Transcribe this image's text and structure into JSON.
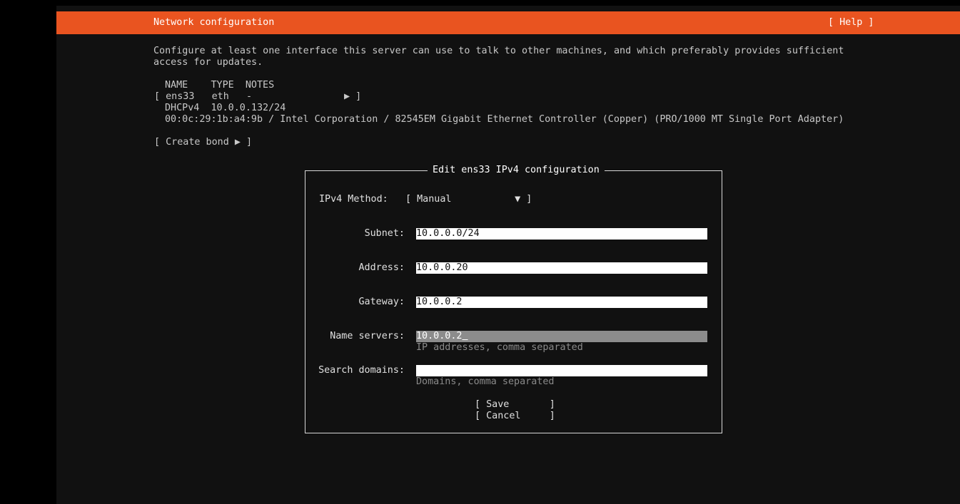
{
  "header": {
    "title": "Network configuration",
    "help": "[ Help ]"
  },
  "intro": {
    "line1": "Configure at least one interface this server can use to talk to other machines, and which preferably provides sufficient",
    "line2": "access for updates."
  },
  "interfaces": {
    "col_header": "NAME    TYPE  NOTES",
    "row": "[ ens33   eth   -                ▶ ]",
    "dhcp": "DHCPv4  10.0.0.132/24",
    "hw": "00:0c:29:1b:a4:9b / Intel Corporation / 82545EM Gigabit Ethernet Controller (Copper) (PRO/1000 MT Single Port Adapter)",
    "create_bond": "[ Create bond ▶ ]"
  },
  "dialog": {
    "title": "Edit ens33 IPv4 configuration",
    "method_label": "IPv4 Method:",
    "method_value": "[ Manual           ▼ ]",
    "subnet_label": "Subnet:",
    "subnet_value": "10.0.0.0/24",
    "address_label": "Address:",
    "address_value": "10.0.0.20",
    "gateway_label": "Gateway:",
    "gateway_value": "10.0.0.2",
    "nameservers_label": "Name servers:",
    "nameservers_value": "10.0.0.2",
    "nameservers_hint": "IP addresses, comma separated",
    "search_label": "Search domains:",
    "search_value": "",
    "search_hint": "Domains, comma separated",
    "save": "[ Save       ]",
    "cancel": "[ Cancel     ]"
  },
  "colors": {
    "accent": "#e95420",
    "background": "#111111"
  }
}
